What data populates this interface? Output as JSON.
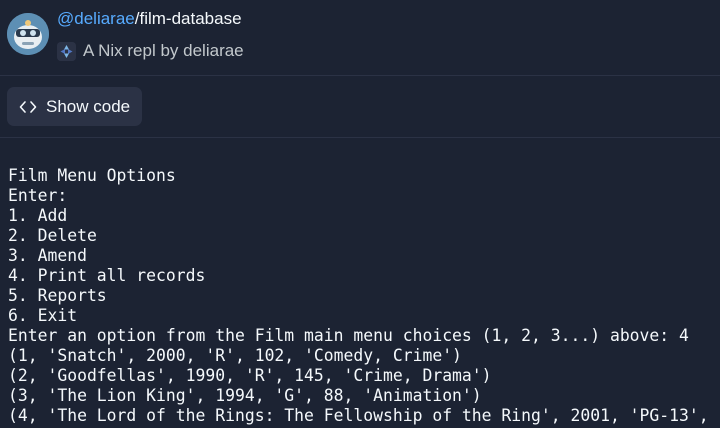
{
  "header": {
    "owner": "@deliarae",
    "slash_repl": "/film-database",
    "subtitle": "A Nix repl by deliarae",
    "avatar_icon": "avatar-icon",
    "language_icon": "nix-snowflake-icon"
  },
  "toolbar": {
    "show_code_label": "Show code",
    "show_code_icon": "code-brackets-icon"
  },
  "console": {
    "lines": [
      "Film Menu Options",
      "Enter:",
      "1. Add",
      "2. Delete",
      "3. Amend",
      "4. Print all records",
      "5. Reports",
      "6. Exit",
      "Enter an option from the Film main menu choices (1, 2, 3...) above: 4",
      "(1, 'Snatch', 2000, 'R', 102, 'Comedy, Crime')",
      "(2, 'Goodfellas', 1990, 'R', 145, 'Crime, Drama')",
      "(3, 'The Lion King', 1994, 'G', 88, 'Animation')",
      "(4, 'The Lord of the Rings: The Fellowship of the Ring', 2001, 'PG-13',"
    ]
  },
  "colors": {
    "background": "#1c2333",
    "link": "#57abff",
    "text": "#f5f9fc",
    "muted": "#c2c8cc",
    "button": "#2b3245"
  }
}
